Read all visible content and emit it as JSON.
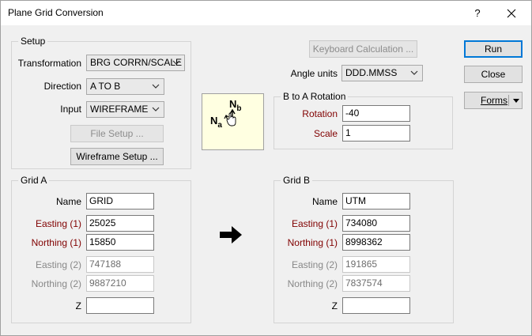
{
  "window": {
    "title": "Plane Grid Conversion",
    "help_label": "?"
  },
  "setup": {
    "label": "Setup",
    "transformation_label": "Transformation",
    "transformation_value": "BRG CORRN/SCALE",
    "direction_label": "Direction",
    "direction_value": "A TO B",
    "input_label": "Input",
    "input_value": "WIREFRAME",
    "file_setup_label": "File Setup ...",
    "wireframe_setup_label": "Wireframe Setup ..."
  },
  "keyboard_calc_label": "Keyboard Calculation ...",
  "angle_units": {
    "label": "Angle units",
    "value": "DDD.MMSS"
  },
  "rotation_group": {
    "label": "B to A Rotation",
    "rotation_label": "Rotation",
    "rotation_value": "-40",
    "scale_label": "Scale",
    "scale_value": "1"
  },
  "preview": {
    "nb_main": "N",
    "nb_sub": "b",
    "na_main": "N",
    "na_sub": "a"
  },
  "grid_a": {
    "label": "Grid A",
    "name_label": "Name",
    "name_value": "GRID",
    "easting1_label": "Easting (1)",
    "easting1_value": "25025",
    "northing1_label": "Northing (1)",
    "northing1_value": "15850",
    "easting2_label": "Easting (2)",
    "easting2_value": "747188",
    "northing2_label": "Northing (2)",
    "northing2_value": "9887210",
    "z_label": "Z",
    "z_value": ""
  },
  "grid_b": {
    "label": "Grid B",
    "name_label": "Name",
    "name_value": "UTM",
    "easting1_label": "Easting (1)",
    "easting1_value": "734080",
    "northing1_label": "Northing (1)",
    "northing1_value": "8998362",
    "easting2_label": "Easting (2)",
    "easting2_value": "191865",
    "northing2_label": "Northing (2)",
    "northing2_value": "7837574",
    "z_label": "Z",
    "z_value": ""
  },
  "buttons": {
    "run": "Run",
    "close": "Close",
    "forms": "Forms"
  },
  "colors": {
    "required_label": "#800000",
    "disabled_text": "#888888",
    "preview_bg": "#ffffe1",
    "default_border": "#0078d7"
  }
}
